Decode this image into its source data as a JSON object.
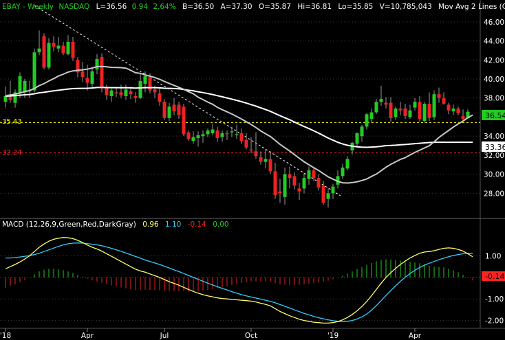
{
  "header": {
    "symbol": "EBAY",
    "period": "Weekly",
    "exchange": "NASDAQ",
    "last": "L=36.56",
    "change": "0.94",
    "change_pct": "2.64%",
    "bid": "B=36.50",
    "ask": "A=37.30",
    "open": "O=35.87",
    "high": "Hi=36.81",
    "low": "Lo=35.85",
    "volume": "V=10,785,043",
    "study": "Mov Avg 2 Lines (Close,20, ..."
  },
  "macd_header": {
    "label": "MACD (12,26,9,Green,Red,DarkGray)",
    "macd": "0.96",
    "signal": "1.10",
    "hist": "-0.14",
    "zero": "0.00"
  },
  "colors": {
    "background": "#000000",
    "up": "#22cc22",
    "down": "#ee2222",
    "ma20": "#c8c8c8",
    "ma50": "#ffffff",
    "macd": "#ffff66",
    "signal": "#33ccff",
    "h_yellow": "#ffff00",
    "h_red": "#ff2222",
    "axis_text": "#ffffff",
    "grid": "#3c3c3c"
  },
  "chart_data": [
    {
      "type": "candlestick",
      "ylim": [
        25.5,
        47
      ],
      "y_ticks": [
        "28.00",
        "30.00",
        "32.00",
        "34.00",
        "36.00",
        "38.00",
        "40.00",
        "42.00",
        "44.00",
        "46.00"
      ],
      "x_tick_labels": [
        "'18",
        "Apr",
        "Jul",
        "Oct",
        "'19",
        "Apr"
      ],
      "price_labels": {
        "last": "36.54",
        "ma50": "33.36",
        "yellow_line": "35.43",
        "red_line": "32.24"
      },
      "hlines": {
        "yellow": 35.43,
        "red": 32.24
      },
      "ohlc": [
        [
          37.6,
          39.2,
          37.0,
          38.2
        ],
        [
          38.1,
          39.8,
          37.5,
          37.8
        ],
        [
          37.5,
          38.9,
          37.0,
          38.6
        ],
        [
          38.5,
          40.7,
          38.0,
          40.3
        ],
        [
          38.6,
          40.0,
          38.0,
          39.8
        ],
        [
          38.7,
          39.8,
          38.0,
          38.8
        ],
        [
          38.8,
          43.2,
          38.6,
          42.8
        ],
        [
          42.8,
          45.1,
          42.5,
          43.2
        ],
        [
          44.5,
          44.8,
          41.0,
          41.2
        ],
        [
          41.2,
          44.3,
          41.0,
          43.8
        ],
        [
          43.8,
          44.5,
          42.9,
          43.4
        ],
        [
          43.2,
          44.4,
          42.8,
          43.5
        ],
        [
          43.5,
          43.9,
          42.5,
          42.7
        ],
        [
          42.6,
          44.6,
          42.5,
          43.9
        ],
        [
          43.9,
          44.4,
          41.9,
          42.2
        ],
        [
          42.0,
          42.3,
          40.2,
          40.7
        ],
        [
          40.8,
          41.8,
          39.7,
          40.2
        ],
        [
          40.1,
          41.5,
          38.8,
          39.6
        ],
        [
          39.5,
          41.3,
          39.0,
          40.8
        ],
        [
          41.0,
          42.6,
          40.5,
          42.1
        ],
        [
          42.3,
          42.7,
          38.6,
          39.1
        ],
        [
          39.1,
          39.4,
          37.8,
          38.3
        ],
        [
          38.2,
          39.0,
          37.6,
          38.8
        ],
        [
          38.6,
          39.1,
          38.1,
          38.5
        ],
        [
          38.6,
          39.4,
          38.0,
          38.3
        ],
        [
          38.2,
          39.4,
          37.8,
          38.9
        ],
        [
          38.7,
          39.2,
          37.9,
          38.4
        ],
        [
          38.2,
          38.6,
          37.5,
          38.0
        ],
        [
          38.0,
          40.5,
          37.9,
          39.8
        ],
        [
          39.5,
          40.8,
          38.6,
          40.3
        ],
        [
          40.2,
          40.6,
          38.5,
          38.8
        ],
        [
          38.9,
          39.3,
          38.0,
          38.6
        ],
        [
          38.5,
          39.0,
          37.2,
          37.6
        ],
        [
          37.6,
          37.9,
          35.7,
          35.9
        ],
        [
          35.9,
          37.5,
          35.6,
          37.1
        ],
        [
          37.3,
          38.0,
          36.2,
          36.6
        ],
        [
          37.3,
          37.6,
          35.8,
          36.2
        ],
        [
          37.1,
          37.4,
          34.0,
          34.2
        ],
        [
          34.4,
          34.6,
          33.5,
          33.7
        ],
        [
          33.5,
          34.5,
          33.2,
          33.9
        ],
        [
          33.8,
          34.5,
          32.9,
          34.1
        ],
        [
          34.0,
          34.6,
          33.3,
          34.2
        ],
        [
          34.2,
          34.8,
          33.9,
          34.6
        ],
        [
          34.3,
          35.3,
          34.1,
          34.7
        ],
        [
          34.6,
          35.0,
          33.4,
          33.8
        ],
        [
          33.9,
          34.6,
          33.4,
          34.3
        ],
        [
          34.3,
          34.6,
          33.6,
          34.2
        ],
        [
          34.4,
          35.0,
          33.9,
          34.5
        ],
        [
          34.1,
          35.2,
          33.7,
          34.2
        ],
        [
          34.3,
          34.8,
          33.2,
          33.5
        ],
        [
          33.6,
          34.3,
          32.6,
          32.8
        ],
        [
          32.6,
          33.9,
          32.2,
          32.5
        ],
        [
          32.4,
          34.4,
          31.6,
          31.9
        ],
        [
          31.8,
          32.4,
          31.0,
          31.3
        ],
        [
          31.3,
          32.6,
          30.6,
          31.6
        ],
        [
          31.6,
          32.4,
          30.0,
          30.3
        ],
        [
          30.3,
          31.2,
          27.4,
          27.8
        ],
        [
          28.2,
          29.5,
          27.0,
          28.0
        ],
        [
          27.6,
          30.7,
          26.8,
          30.0
        ],
        [
          30.0,
          30.8,
          28.5,
          29.6
        ],
        [
          29.8,
          30.2,
          28.4,
          28.8
        ],
        [
          28.5,
          29.1,
          27.3,
          28.2
        ],
        [
          28.5,
          30.1,
          28.0,
          29.6
        ],
        [
          29.5,
          30.8,
          28.9,
          30.4
        ],
        [
          30.4,
          30.7,
          29.3,
          29.6
        ],
        [
          29.6,
          30.0,
          28.3,
          28.6
        ],
        [
          28.8,
          29.3,
          26.8,
          27.0
        ],
        [
          27.4,
          28.5,
          26.5,
          28.0
        ],
        [
          28.0,
          29.0,
          27.4,
          28.7
        ],
        [
          28.9,
          30.4,
          28.5,
          29.8
        ],
        [
          29.8,
          31.1,
          29.5,
          30.7
        ],
        [
          30.6,
          31.9,
          30.4,
          31.6
        ],
        [
          32.5,
          33.4,
          32.1,
          33.3
        ],
        [
          33.2,
          34.4,
          32.9,
          34.3
        ],
        [
          34.0,
          35.2,
          33.4,
          35.0
        ],
        [
          35.0,
          36.4,
          34.7,
          36.3
        ],
        [
          35.8,
          36.9,
          35.4,
          36.5
        ],
        [
          36.5,
          37.9,
          36.3,
          37.6
        ],
        [
          37.6,
          39.3,
          37.2,
          37.9
        ],
        [
          37.5,
          38.1,
          36.9,
          37.3
        ],
        [
          37.5,
          38.1,
          35.5,
          35.9
        ],
        [
          36.0,
          37.1,
          35.7,
          36.9
        ],
        [
          36.9,
          37.6,
          36.2,
          36.7
        ],
        [
          36.9,
          37.4,
          35.8,
          36.1
        ],
        [
          36.0,
          37.3,
          35.8,
          36.7
        ],
        [
          37.0,
          38.0,
          36.7,
          37.6
        ],
        [
          37.6,
          38.2,
          35.5,
          35.8
        ],
        [
          35.6,
          37.6,
          35.4,
          37.4
        ],
        [
          37.4,
          38.6,
          35.6,
          35.9
        ],
        [
          36.0,
          38.8,
          35.7,
          38.4
        ],
        [
          38.4,
          39.1,
          37.5,
          38.0
        ],
        [
          38.0,
          38.6,
          37.3,
          37.4
        ],
        [
          37.3,
          37.5,
          36.3,
          36.7
        ],
        [
          36.6,
          37.3,
          36.2,
          36.9
        ],
        [
          36.9,
          37.1,
          36.2,
          36.4
        ],
        [
          36.1,
          36.8,
          35.6,
          35.8
        ],
        [
          35.87,
          36.81,
          35.85,
          36.56
        ]
      ],
      "ma20": [
        38.25,
        38.32,
        38.4,
        38.53,
        38.67,
        38.79,
        39.01,
        39.31,
        39.52,
        39.79,
        40.04,
        40.31,
        40.51,
        40.73,
        40.85,
        40.91,
        40.97,
        41.03,
        41.14,
        41.31,
        41.32,
        41.28,
        41.22,
        41.21,
        41.19,
        41.14,
        40.91,
        40.66,
        40.59,
        40.43,
        40.3,
        40.16,
        39.97,
        39.74,
        39.53,
        39.33,
        39.12,
        38.92,
        38.67,
        38.44,
        38.09,
        37.84,
        37.58,
        37.35,
        37.02,
        36.78,
        36.55,
        36.32,
        36.06,
        35.8,
        35.51,
        35.22,
        34.9,
        34.55,
        34.25,
        33.96,
        33.55,
        33.14,
        32.78,
        32.44,
        32.05,
        31.67,
        31.31,
        30.99,
        30.69,
        30.4,
        30.06,
        29.73,
        29.48,
        29.25,
        29.1,
        29.07,
        29.12,
        29.21,
        29.34,
        29.5,
        29.77,
        30.02,
        30.36,
        30.73,
        31.04,
        31.3,
        31.56,
        31.74,
        32.02,
        32.29,
        32.53,
        32.76,
        32.99,
        33.41,
        33.86,
        34.24,
        34.59,
        34.96,
        35.28,
        35.58,
        35.93,
        36.22
      ],
      "ma50": [
        38.2,
        38.22,
        38.25,
        38.3,
        38.34,
        38.37,
        38.45,
        38.55,
        38.6,
        38.68,
        38.75,
        38.82,
        38.88,
        38.95,
        38.99,
        39.01,
        39.02,
        39.03,
        39.06,
        39.11,
        39.11,
        39.1,
        39.09,
        39.09,
        39.08,
        39.08,
        39.07,
        39.05,
        39.07,
        39.09,
        39.09,
        39.09,
        39.07,
        39.03,
        39.02,
        39.0,
        38.97,
        38.9,
        38.82,
        38.75,
        38.66,
        38.57,
        38.47,
        38.37,
        38.25,
        38.13,
        38.01,
        37.89,
        37.76,
        37.62,
        37.47,
        37.31,
        37.15,
        36.97,
        36.79,
        36.6,
        36.37,
        36.15,
        35.93,
        35.72,
        35.48,
        35.24,
        35.01,
        34.79,
        34.56,
        34.32,
        34.06,
        33.8,
        33.57,
        33.35,
        33.18,
        33.04,
        32.95,
        32.88,
        32.84,
        32.82,
        32.85,
        32.88,
        32.93,
        33.0,
        33.02,
        33.05,
        33.09,
        33.12,
        33.16,
        33.21,
        33.25,
        33.29,
        33.33,
        33.36,
        33.36,
        33.36,
        33.36,
        33.36,
        33.36,
        33.36,
        33.36,
        33.36
      ]
    },
    {
      "type": "line",
      "name": "MACD",
      "ylim": [
        -2.3,
        2.1
      ],
      "y_ticks": [
        "1.00",
        "-1.00",
        "-2.00"
      ],
      "hist_label": "-0.14",
      "macd": [
        0.4,
        0.5,
        0.6,
        0.72,
        0.85,
        1.0,
        1.2,
        1.4,
        1.55,
        1.68,
        1.77,
        1.82,
        1.85,
        1.84,
        1.8,
        1.72,
        1.62,
        1.5,
        1.4,
        1.32,
        1.22,
        1.1,
        0.98,
        0.86,
        0.74,
        0.62,
        0.5,
        0.38,
        0.3,
        0.24,
        0.16,
        0.08,
        0.0,
        -0.1,
        -0.2,
        -0.28,
        -0.36,
        -0.46,
        -0.56,
        -0.65,
        -0.73,
        -0.8,
        -0.86,
        -0.9,
        -0.95,
        -0.98,
        -1.0,
        -1.02,
        -1.04,
        -1.06,
        -1.08,
        -1.1,
        -1.14,
        -1.2,
        -1.25,
        -1.32,
        -1.45,
        -1.58,
        -1.68,
        -1.78,
        -1.86,
        -1.94,
        -2.0,
        -2.04,
        -2.08,
        -2.1,
        -2.12,
        -2.12,
        -2.1,
        -2.05,
        -1.97,
        -1.86,
        -1.72,
        -1.55,
        -1.35,
        -1.12,
        -0.85,
        -0.56,
        -0.27,
        0.0,
        0.22,
        0.42,
        0.6,
        0.76,
        0.9,
        1.02,
        1.12,
        1.18,
        1.2,
        1.24,
        1.3,
        1.35,
        1.37,
        1.35,
        1.3,
        1.22,
        1.1,
        0.96
      ],
      "signal": [
        0.9,
        0.9,
        0.92,
        0.95,
        0.98,
        1.01,
        1.06,
        1.12,
        1.2,
        1.28,
        1.36,
        1.44,
        1.51,
        1.56,
        1.59,
        1.6,
        1.59,
        1.57,
        1.54,
        1.51,
        1.47,
        1.41,
        1.35,
        1.28,
        1.21,
        1.13,
        1.05,
        0.97,
        0.89,
        0.81,
        0.74,
        0.67,
        0.6,
        0.52,
        0.44,
        0.35,
        0.27,
        0.18,
        0.09,
        0.0,
        -0.09,
        -0.18,
        -0.27,
        -0.35,
        -0.43,
        -0.51,
        -0.58,
        -0.66,
        -0.73,
        -0.8,
        -0.86,
        -0.91,
        -0.96,
        -1.01,
        -1.06,
        -1.11,
        -1.18,
        -1.26,
        -1.34,
        -1.42,
        -1.51,
        -1.59,
        -1.67,
        -1.74,
        -1.81,
        -1.87,
        -1.92,
        -1.97,
        -2.01,
        -2.04,
        -2.05,
        -2.04,
        -2.0,
        -1.93,
        -1.83,
        -1.7,
        -1.52,
        -1.31,
        -1.08,
        -0.84,
        -0.61,
        -0.39,
        -0.18,
        0.01,
        0.18,
        0.33,
        0.46,
        0.57,
        0.66,
        0.74,
        0.82,
        0.89,
        0.96,
        1.02,
        1.06,
        1.1,
        1.12,
        1.1
      ]
    }
  ]
}
